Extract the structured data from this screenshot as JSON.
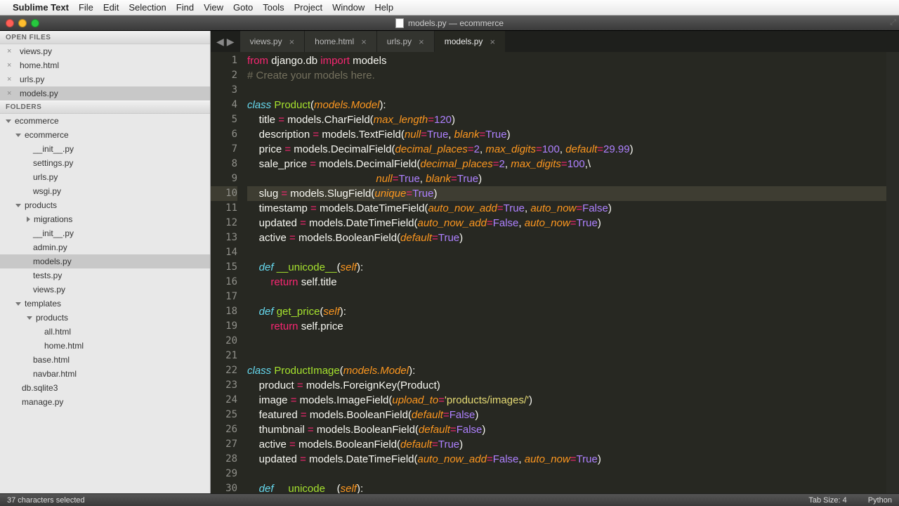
{
  "menubar": {
    "app": "Sublime Text",
    "items": [
      "File",
      "Edit",
      "Selection",
      "Find",
      "View",
      "Goto",
      "Tools",
      "Project",
      "Window",
      "Help"
    ]
  },
  "window": {
    "title": "models.py — ecommerce"
  },
  "sidebar": {
    "open_files_header": "OPEN FILES",
    "open_files": [
      "views.py",
      "home.html",
      "urls.py",
      "models.py"
    ],
    "open_files_selected": 3,
    "folders_header": "FOLDERS",
    "tree": [
      {
        "label": "ecommerce",
        "depth": 0,
        "type": "folder",
        "open": true
      },
      {
        "label": "ecommerce",
        "depth": 1,
        "type": "folder",
        "open": true
      },
      {
        "label": "__init__.py",
        "depth": 2,
        "type": "file"
      },
      {
        "label": "settings.py",
        "depth": 2,
        "type": "file"
      },
      {
        "label": "urls.py",
        "depth": 2,
        "type": "file"
      },
      {
        "label": "wsgi.py",
        "depth": 2,
        "type": "file"
      },
      {
        "label": "products",
        "depth": 1,
        "type": "folder",
        "open": true
      },
      {
        "label": "migrations",
        "depth": 2,
        "type": "folder",
        "open": false
      },
      {
        "label": "__init__.py",
        "depth": 2,
        "type": "file"
      },
      {
        "label": "admin.py",
        "depth": 2,
        "type": "file"
      },
      {
        "label": "models.py",
        "depth": 2,
        "type": "file",
        "selected": true
      },
      {
        "label": "tests.py",
        "depth": 2,
        "type": "file"
      },
      {
        "label": "views.py",
        "depth": 2,
        "type": "file"
      },
      {
        "label": "templates",
        "depth": 1,
        "type": "folder",
        "open": true
      },
      {
        "label": "products",
        "depth": 2,
        "type": "folder",
        "open": true
      },
      {
        "label": "all.html",
        "depth": 3,
        "type": "file"
      },
      {
        "label": "home.html",
        "depth": 3,
        "type": "file"
      },
      {
        "label": "base.html",
        "depth": 2,
        "type": "file"
      },
      {
        "label": "navbar.html",
        "depth": 2,
        "type": "file"
      },
      {
        "label": "db.sqlite3",
        "depth": 1,
        "type": "file"
      },
      {
        "label": "manage.py",
        "depth": 1,
        "type": "file"
      }
    ]
  },
  "tabs": {
    "items": [
      {
        "label": "views.py"
      },
      {
        "label": "home.html"
      },
      {
        "label": "urls.py"
      },
      {
        "label": "models.py",
        "active": true
      }
    ]
  },
  "code": {
    "first_line": 1,
    "highlighted_line": 10,
    "lines": [
      [
        {
          "t": "from ",
          "c": "kw2"
        },
        {
          "t": "django.db ",
          "c": ""
        },
        {
          "t": "import ",
          "c": "kw2"
        },
        {
          "t": "models",
          "c": ""
        }
      ],
      [
        {
          "t": "# Create your models here.",
          "c": "cmt"
        }
      ],
      [],
      [
        {
          "t": "class ",
          "c": "kw"
        },
        {
          "t": "Product",
          "c": "fn"
        },
        {
          "t": "(",
          "c": ""
        },
        {
          "t": "models.Model",
          "c": "param"
        },
        {
          "t": "):",
          "c": ""
        }
      ],
      [
        {
          "t": "    title ",
          "c": ""
        },
        {
          "t": "= ",
          "c": "kw2"
        },
        {
          "t": "models.CharField(",
          "c": ""
        },
        {
          "t": "max_length",
          "c": "param"
        },
        {
          "t": "=",
          "c": "kw2"
        },
        {
          "t": "120",
          "c": "num"
        },
        {
          "t": ")",
          "c": ""
        }
      ],
      [
        {
          "t": "    description ",
          "c": ""
        },
        {
          "t": "= ",
          "c": "kw2"
        },
        {
          "t": "models.TextField(",
          "c": ""
        },
        {
          "t": "null",
          "c": "param"
        },
        {
          "t": "=",
          "c": "kw2"
        },
        {
          "t": "True",
          "c": "num"
        },
        {
          "t": ", ",
          "c": ""
        },
        {
          "t": "blank",
          "c": "param"
        },
        {
          "t": "=",
          "c": "kw2"
        },
        {
          "t": "True",
          "c": "num"
        },
        {
          "t": ")",
          "c": ""
        }
      ],
      [
        {
          "t": "    price ",
          "c": ""
        },
        {
          "t": "= ",
          "c": "kw2"
        },
        {
          "t": "models.DecimalField(",
          "c": ""
        },
        {
          "t": "decimal_places",
          "c": "param"
        },
        {
          "t": "=",
          "c": "kw2"
        },
        {
          "t": "2",
          "c": "num"
        },
        {
          "t": ", ",
          "c": ""
        },
        {
          "t": "max_digits",
          "c": "param"
        },
        {
          "t": "=",
          "c": "kw2"
        },
        {
          "t": "100",
          "c": "num"
        },
        {
          "t": ", ",
          "c": ""
        },
        {
          "t": "default",
          "c": "param"
        },
        {
          "t": "=",
          "c": "kw2"
        },
        {
          "t": "29.99",
          "c": "num"
        },
        {
          "t": ")",
          "c": ""
        }
      ],
      [
        {
          "t": "    sale_price ",
          "c": ""
        },
        {
          "t": "= ",
          "c": "kw2"
        },
        {
          "t": "models.DecimalField(",
          "c": ""
        },
        {
          "t": "decimal_places",
          "c": "param"
        },
        {
          "t": "=",
          "c": "kw2"
        },
        {
          "t": "2",
          "c": "num"
        },
        {
          "t": ", ",
          "c": ""
        },
        {
          "t": "max_digits",
          "c": "param"
        },
        {
          "t": "=",
          "c": "kw2"
        },
        {
          "t": "100",
          "c": "num"
        },
        {
          "t": ",\\",
          "c": ""
        }
      ],
      [
        {
          "t": "                                            ",
          "c": ""
        },
        {
          "t": "null",
          "c": "param"
        },
        {
          "t": "=",
          "c": "kw2"
        },
        {
          "t": "True",
          "c": "num"
        },
        {
          "t": ", ",
          "c": ""
        },
        {
          "t": "blank",
          "c": "param"
        },
        {
          "t": "=",
          "c": "kw2"
        },
        {
          "t": "True",
          "c": "num"
        },
        {
          "t": ")",
          "c": ""
        }
      ],
      [
        {
          "t": "    slug ",
          "c": ""
        },
        {
          "t": "= ",
          "c": "kw2"
        },
        {
          "t": "models.SlugField(",
          "c": ""
        },
        {
          "t": "unique",
          "c": "param"
        },
        {
          "t": "=",
          "c": "kw2"
        },
        {
          "t": "True",
          "c": "num"
        },
        {
          "t": ")",
          "c": ""
        }
      ],
      [
        {
          "t": "    timestamp ",
          "c": ""
        },
        {
          "t": "= ",
          "c": "kw2"
        },
        {
          "t": "models.DateTimeField(",
          "c": ""
        },
        {
          "t": "auto_now_add",
          "c": "param"
        },
        {
          "t": "=",
          "c": "kw2"
        },
        {
          "t": "True",
          "c": "num"
        },
        {
          "t": ", ",
          "c": ""
        },
        {
          "t": "auto_now",
          "c": "param"
        },
        {
          "t": "=",
          "c": "kw2"
        },
        {
          "t": "False",
          "c": "num"
        },
        {
          "t": ")",
          "c": ""
        }
      ],
      [
        {
          "t": "    updated ",
          "c": ""
        },
        {
          "t": "= ",
          "c": "kw2"
        },
        {
          "t": "models.DateTimeField(",
          "c": ""
        },
        {
          "t": "auto_now_add",
          "c": "param"
        },
        {
          "t": "=",
          "c": "kw2"
        },
        {
          "t": "False",
          "c": "num"
        },
        {
          "t": ", ",
          "c": ""
        },
        {
          "t": "auto_now",
          "c": "param"
        },
        {
          "t": "=",
          "c": "kw2"
        },
        {
          "t": "True",
          "c": "num"
        },
        {
          "t": ")",
          "c": ""
        }
      ],
      [
        {
          "t": "    active ",
          "c": ""
        },
        {
          "t": "= ",
          "c": "kw2"
        },
        {
          "t": "models.BooleanField(",
          "c": ""
        },
        {
          "t": "default",
          "c": "param"
        },
        {
          "t": "=",
          "c": "kw2"
        },
        {
          "t": "True",
          "c": "num"
        },
        {
          "t": ")",
          "c": ""
        }
      ],
      [],
      [
        {
          "t": "    ",
          "c": ""
        },
        {
          "t": "def ",
          "c": "kw"
        },
        {
          "t": "__unicode__",
          "c": "fn"
        },
        {
          "t": "(",
          "c": ""
        },
        {
          "t": "self",
          "c": "param"
        },
        {
          "t": "):",
          "c": ""
        }
      ],
      [
        {
          "t": "        ",
          "c": ""
        },
        {
          "t": "return ",
          "c": "kw2"
        },
        {
          "t": "self.title",
          "c": ""
        }
      ],
      [],
      [
        {
          "t": "    ",
          "c": ""
        },
        {
          "t": "def ",
          "c": "kw"
        },
        {
          "t": "get_price",
          "c": "fn"
        },
        {
          "t": "(",
          "c": ""
        },
        {
          "t": "self",
          "c": "param"
        },
        {
          "t": "):",
          "c": ""
        }
      ],
      [
        {
          "t": "        ",
          "c": ""
        },
        {
          "t": "return ",
          "c": "kw2"
        },
        {
          "t": "self.price",
          "c": ""
        }
      ],
      [],
      [],
      [
        {
          "t": "class ",
          "c": "kw"
        },
        {
          "t": "ProductImage",
          "c": "fn"
        },
        {
          "t": "(",
          "c": ""
        },
        {
          "t": "models.Model",
          "c": "param"
        },
        {
          "t": "):",
          "c": ""
        }
      ],
      [
        {
          "t": "    product ",
          "c": ""
        },
        {
          "t": "= ",
          "c": "kw2"
        },
        {
          "t": "models.ForeignKey(Product)",
          "c": ""
        }
      ],
      [
        {
          "t": "    image ",
          "c": ""
        },
        {
          "t": "= ",
          "c": "kw2"
        },
        {
          "t": "models.ImageField(",
          "c": ""
        },
        {
          "t": "upload_to",
          "c": "param"
        },
        {
          "t": "=",
          "c": "kw2"
        },
        {
          "t": "'products/images/'",
          "c": "str"
        },
        {
          "t": ")",
          "c": ""
        }
      ],
      [
        {
          "t": "    featured ",
          "c": ""
        },
        {
          "t": "= ",
          "c": "kw2"
        },
        {
          "t": "models.BooleanField(",
          "c": ""
        },
        {
          "t": "default",
          "c": "param"
        },
        {
          "t": "=",
          "c": "kw2"
        },
        {
          "t": "False",
          "c": "num"
        },
        {
          "t": ")",
          "c": ""
        }
      ],
      [
        {
          "t": "    thumbnail ",
          "c": ""
        },
        {
          "t": "= ",
          "c": "kw2"
        },
        {
          "t": "models.BooleanField(",
          "c": ""
        },
        {
          "t": "default",
          "c": "param"
        },
        {
          "t": "=",
          "c": "kw2"
        },
        {
          "t": "False",
          "c": "num"
        },
        {
          "t": ")",
          "c": ""
        }
      ],
      [
        {
          "t": "    active ",
          "c": ""
        },
        {
          "t": "= ",
          "c": "kw2"
        },
        {
          "t": "models.BooleanField(",
          "c": ""
        },
        {
          "t": "default",
          "c": "param"
        },
        {
          "t": "=",
          "c": "kw2"
        },
        {
          "t": "True",
          "c": "num"
        },
        {
          "t": ")",
          "c": ""
        }
      ],
      [
        {
          "t": "    updated ",
          "c": ""
        },
        {
          "t": "= ",
          "c": "kw2"
        },
        {
          "t": "models.DateTimeField(",
          "c": ""
        },
        {
          "t": "auto_now_add",
          "c": "param"
        },
        {
          "t": "=",
          "c": "kw2"
        },
        {
          "t": "False",
          "c": "num"
        },
        {
          "t": ", ",
          "c": ""
        },
        {
          "t": "auto_now",
          "c": "param"
        },
        {
          "t": "=",
          "c": "kw2"
        },
        {
          "t": "True",
          "c": "num"
        },
        {
          "t": ")",
          "c": ""
        }
      ],
      [],
      [
        {
          "t": "    ",
          "c": ""
        },
        {
          "t": "def ",
          "c": "kw"
        },
        {
          "t": "__unicode__",
          "c": "fn"
        },
        {
          "t": "(",
          "c": ""
        },
        {
          "t": "self",
          "c": "param"
        },
        {
          "t": "):",
          "c": ""
        }
      ]
    ]
  },
  "statusbar": {
    "left": "37 characters selected",
    "tab_size": "Tab Size: 4",
    "syntax": "Python"
  }
}
